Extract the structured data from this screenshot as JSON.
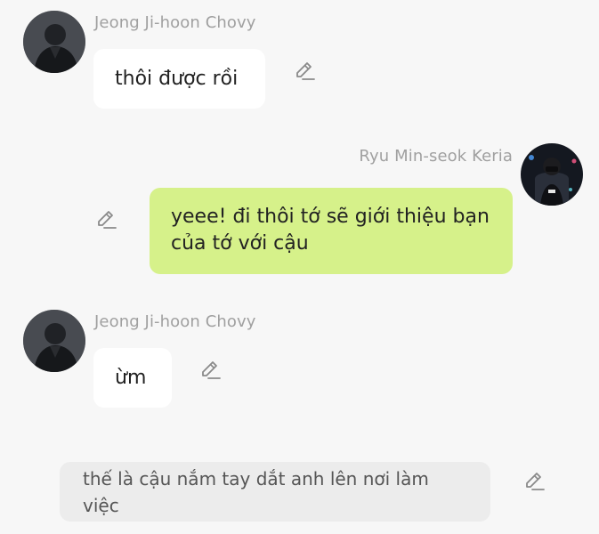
{
  "messages": [
    {
      "sender": "Jeong Ji-hoon  Chovy",
      "text": "thôi được rồi",
      "side": "left",
      "avatar_icon": "profile-photo-dark-jacket"
    },
    {
      "sender": "Ryu Min-seok Keria",
      "text": "yeee! đi thôi tớ sẽ giới thiệu bạn của tớ với cậu",
      "side": "right",
      "avatar_icon": "profile-photo-gaming-chair"
    },
    {
      "sender": "Jeong Ji-hoon  Chovy",
      "text": "ừm",
      "side": "left",
      "avatar_icon": "profile-photo-dark-jacket"
    },
    {
      "sender": "",
      "text": "thế là cậu nắm tay dắt anh lên nơi làm việc",
      "side": "narration"
    }
  ],
  "icons": {
    "edit": "pencil-edit-icon"
  },
  "colors": {
    "background": "#f7f7f7",
    "incoming_bubble": "#ffffff",
    "outgoing_bubble": "#d6f18a",
    "narration_bubble": "#ececec",
    "sender_name": "#a0a0a0"
  }
}
